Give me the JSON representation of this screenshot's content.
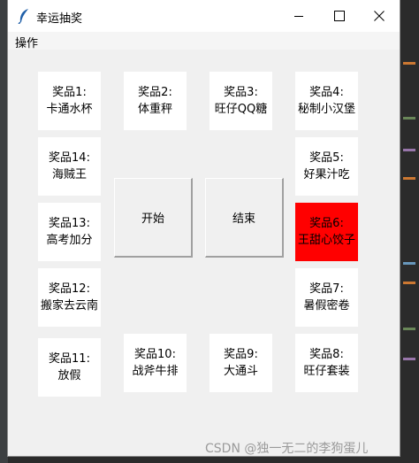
{
  "window": {
    "title": "幸运抽奖",
    "icon": "feather-icon",
    "controls": [
      "minimize-icon",
      "maximize-icon",
      "close-icon"
    ]
  },
  "menu": {
    "items": [
      "操作"
    ]
  },
  "prizes": [
    {
      "label": "奖品1:",
      "name": "卡通水杯"
    },
    {
      "label": "奖品2:",
      "name": "体重秤"
    },
    {
      "label": "奖品3:",
      "name": "旺仔QQ糖"
    },
    {
      "label": "奖品4:",
      "name": "秘制小汉堡"
    },
    {
      "label": "奖品5:",
      "name": "好果汁吃"
    },
    {
      "label": "奖品6:",
      "name": "王甜心饺子"
    },
    {
      "label": "奖品7:",
      "name": "暑假密卷"
    },
    {
      "label": "奖品8:",
      "name": "旺仔套装"
    },
    {
      "label": "奖品9:",
      "name": "大通斗"
    },
    {
      "label": "奖品10:",
      "name": "战斧牛排"
    },
    {
      "label": "奖品11:",
      "name": "放假"
    },
    {
      "label": "奖品12:",
      "name": "搬家去云南"
    },
    {
      "label": "奖品13:",
      "name": "高考加分"
    },
    {
      "label": "奖品14:",
      "name": "海贼王"
    }
  ],
  "highlighted_prize": 6,
  "colors": {
    "highlight": "#ff0000",
    "card": "#ffffff",
    "background": "#f0f0f0"
  },
  "buttons": {
    "start": "开始",
    "stop": "结束"
  },
  "watermark": "CSDN @独一无二的李狗蛋儿"
}
